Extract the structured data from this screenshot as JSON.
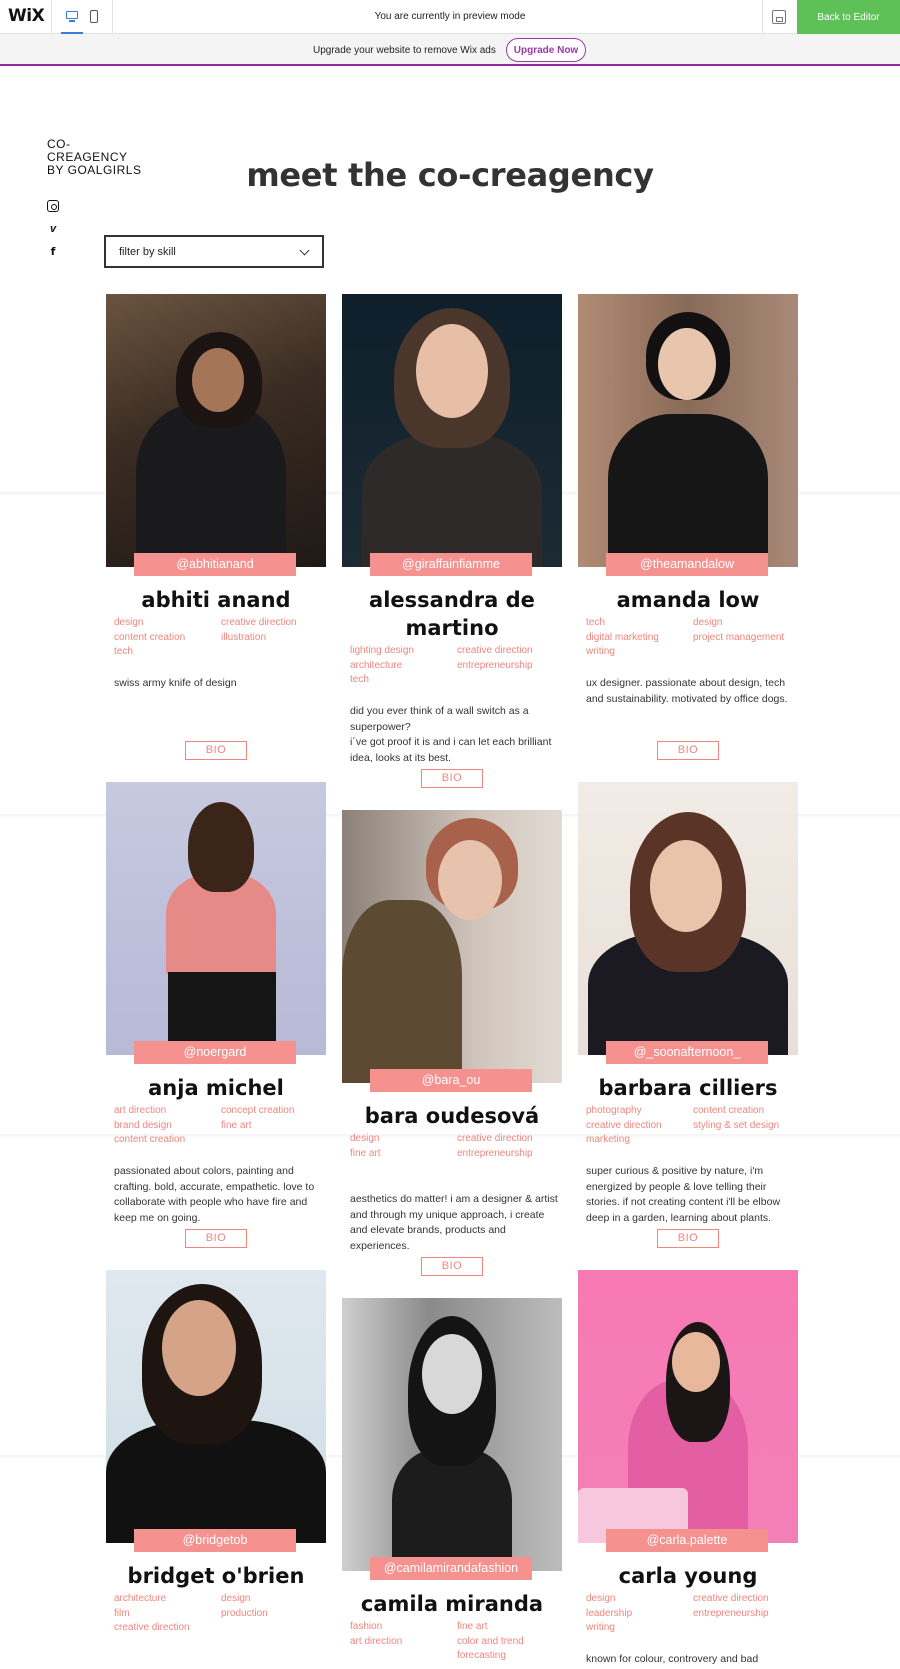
{
  "wix_bar": {
    "logo": "WiX",
    "preview_text": "You are currently in preview mode",
    "back_label": "Back to Editor",
    "upgrade_text": "Upgrade your website to remove Wix ads",
    "upgrade_label": "Upgrade Now"
  },
  "site": {
    "logo_line1": "CO-",
    "logo_line2": "CREAGENCY",
    "logo_line3": "BY GOALGIRLS",
    "social": [
      "instagram-icon",
      "vimeo-icon",
      "facebook-icon"
    ],
    "title": "meet the co-creagency",
    "filter_label": "filter by skill"
  },
  "colors": {
    "accent": "#f5918f",
    "skill": "#f0867f",
    "wix_green": "#5ec158",
    "wix_purple": "#9a39a8"
  },
  "members": [
    {
      "handle": "@abhitianand",
      "name": "abhiti anand",
      "skills": [
        "design",
        "creative direction",
        "content creation",
        "illustration",
        "tech"
      ],
      "desc": "swiss army knife of design",
      "bio": "BIO"
    },
    {
      "handle": "@giraffainfiamme",
      "name": "alessandra de martino",
      "skills": [
        "lighting design",
        "creative direction",
        "architecture",
        "entrepreneurship",
        "tech"
      ],
      "desc": "did you ever think of a wall switch as a superpower?\ni´ve got proof it is and i can let each brilliant idea, looks at its best.",
      "bio": "BIO"
    },
    {
      "handle": "@theamandalow",
      "name": "amanda low",
      "skills": [
        "tech",
        "design",
        "digital marketing",
        "project management",
        "writing"
      ],
      "desc": "ux designer. passionate about design, tech and sustainability. motivated by office dogs.",
      "bio": "BIO"
    },
    {
      "handle": "@noergard",
      "name": "anja michel",
      "skills": [
        "art direction",
        "concept creation",
        "brand design",
        "fine art",
        "content creation"
      ],
      "desc": "passionated about colors, painting and crafting. bold, accurate, empathetic. love to collaborate with people who have fire and keep me on going.",
      "bio": "BIO"
    },
    {
      "handle": "@bara_ou",
      "name": "bara oudesová",
      "skills": [
        "design",
        "creative direction",
        "fine art",
        "entrepreneurship"
      ],
      "desc": "aesthetics do matter! i am a designer & artist and through my unique approach, i create and elevate brands, products and experiences.",
      "bio": "BIO"
    },
    {
      "handle": "@_soonafternoon_",
      "name": "barbara cilliers",
      "skills": [
        "photography",
        "content creation",
        "creative direction",
        "styling & set design",
        "marketing"
      ],
      "desc": "super curious & positive by nature, i'm energized by people & love telling their stories. if not creating content i'll be elbow deep in a garden, learning about plants.",
      "bio": "BIO"
    },
    {
      "handle": "@bridgetob",
      "name": "bridget o'brien",
      "skills": [
        "architecture",
        "design",
        "film",
        "production",
        "creative direction"
      ],
      "desc": "",
      "bio": ""
    },
    {
      "handle": "@camilamirandafashion",
      "name": "camila miranda",
      "skills": [
        "fashion",
        "fine art",
        "art direction",
        "color and trend forecasting"
      ],
      "desc": "",
      "bio": ""
    },
    {
      "handle": "@carla.palette",
      "name": "carla young",
      "skills": [
        "design",
        "creative direction",
        "leadership",
        "entrepreneurship",
        "writing"
      ],
      "desc": "known for colour, controvery and bad",
      "bio": ""
    }
  ]
}
